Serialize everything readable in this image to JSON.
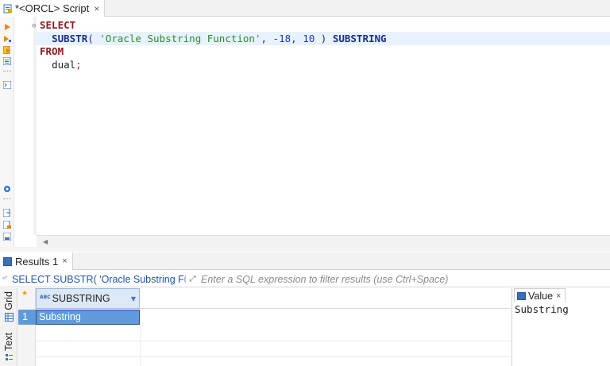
{
  "editor_tab": {
    "title": "*<ORCL> Script",
    "close": "×"
  },
  "sql": {
    "select": "SELECT",
    "fn": "SUBSTR",
    "paren_open": "( ",
    "string": "'Oracle Substring Function'",
    "comma1": ", ",
    "arg1": "-18",
    "comma2": ", ",
    "arg2": "10",
    "paren_close": " ) ",
    "alias": "SUBSTRING",
    "from": "FROM",
    "table": "dual",
    "semicolon": ";"
  },
  "results_tab": {
    "title": "Results 1",
    "close": "×"
  },
  "filter": {
    "query": "SELECT SUBSTR( 'Oracle Substring Func",
    "placeholder": "Enter a SQL expression to filter results (use Ctrl+Space)"
  },
  "side_tabs": {
    "grid": "Grid",
    "text": "Text"
  },
  "grid": {
    "columns": [
      "SUBSTRING"
    ],
    "rows": [
      {
        "num": "1",
        "values": [
          "Substring"
        ]
      }
    ]
  },
  "value_panel": {
    "title": "Value",
    "close": "×",
    "content": "Substring"
  },
  "colors": {
    "selection": "#5f9bdb",
    "keyword": "#8b1a1a",
    "string": "#2a8c2a",
    "number": "#1f35c4"
  }
}
